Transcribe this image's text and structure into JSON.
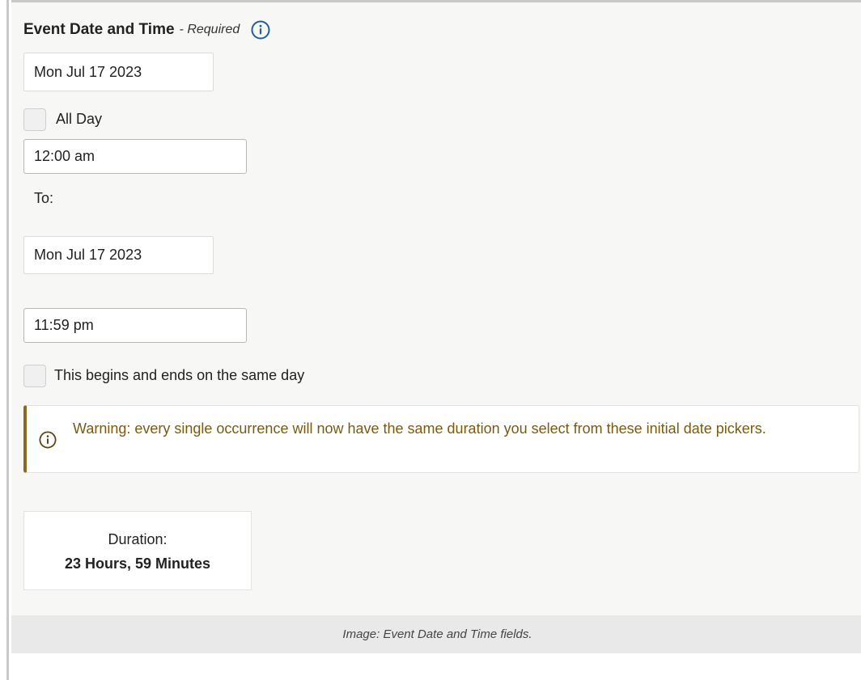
{
  "section": {
    "title": "Event Date and Time",
    "required": "- Required",
    "info_icon": "info-circle-icon"
  },
  "start": {
    "date": "Mon Jul 17 2023",
    "all_day_label": "All Day",
    "all_day_checked": false,
    "time": "12:00 am"
  },
  "to_label": "To:",
  "end": {
    "date": "Mon Jul 17 2023",
    "time": "11:59 pm"
  },
  "same_day": {
    "label": "This begins and ends on the same day",
    "checked": false
  },
  "warning": {
    "icon": "info-circle-icon",
    "text": "Warning: every single occurrence will now have the same duration you select from these initial date pickers.",
    "color": "#7a5a10"
  },
  "duration": {
    "label": "Duration:",
    "value": "23 Hours, 59 Minutes"
  },
  "caption": "Image: Event Date and Time fields.",
  "colors": {
    "accent_blue": "#1f5fa0",
    "warning_border": "#8a6a1f"
  }
}
